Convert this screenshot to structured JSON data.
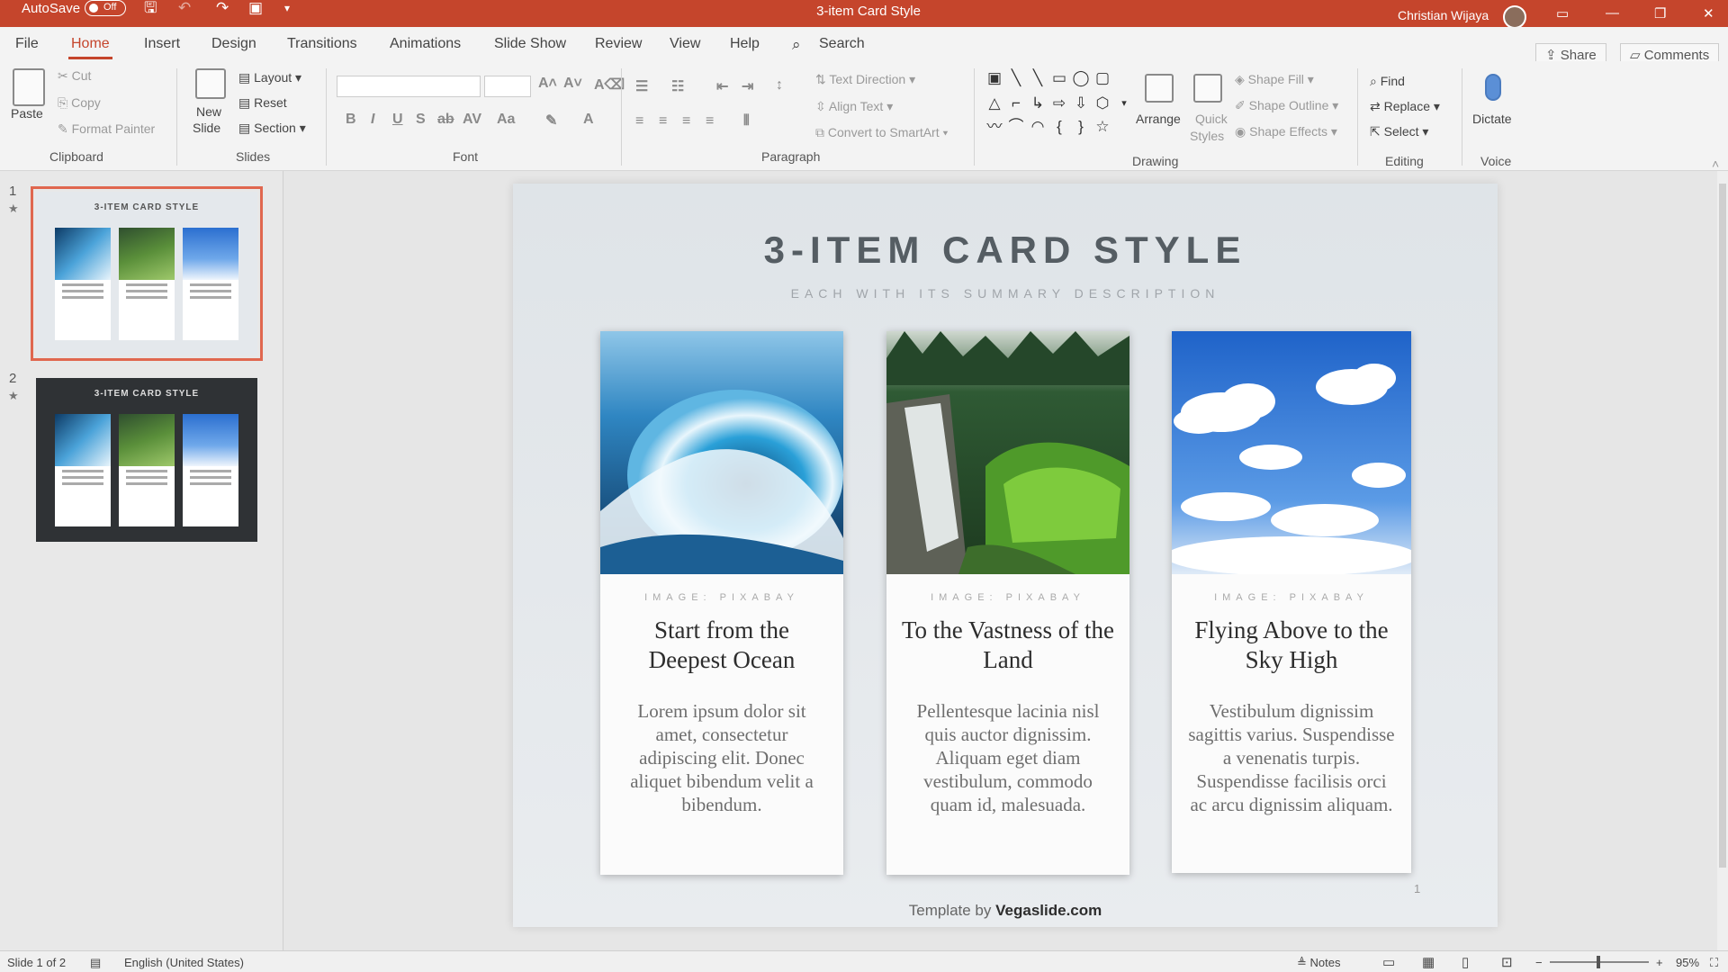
{
  "titlebar": {
    "autosave_label": "AutoSave",
    "autosave_state": "Off",
    "document_title": "3-item Card Style",
    "user_name": "Christian Wijaya"
  },
  "tabs": [
    "File",
    "Home",
    "Insert",
    "Design",
    "Transitions",
    "Animations",
    "Slide Show",
    "Review",
    "View",
    "Help"
  ],
  "active_tab": "Home",
  "search_label": "Search",
  "share_label": "Share",
  "comments_label": "Comments",
  "ribbon": {
    "clipboard": {
      "paste": "Paste",
      "cut": "Cut",
      "copy": "Copy",
      "format_painter": "Format Painter",
      "label": "Clipboard"
    },
    "slides": {
      "new_slide_line1": "New",
      "new_slide_line2": "Slide",
      "layout": "Layout",
      "reset": "Reset",
      "section": "Section",
      "label": "Slides"
    },
    "font": {
      "label": "Font"
    },
    "paragraph": {
      "text_direction": "Text Direction",
      "align_text": "Align Text",
      "convert_smartart": "Convert to SmartArt",
      "label": "Paragraph"
    },
    "drawing": {
      "arrange": "Arrange",
      "quick_line1": "Quick",
      "quick_line2": "Styles",
      "shape_fill": "Shape Fill",
      "shape_outline": "Shape Outline",
      "shape_effects": "Shape Effects",
      "label": "Drawing"
    },
    "editing": {
      "find": "Find",
      "replace": "Replace",
      "select": "Select",
      "label": "Editing"
    },
    "voice": {
      "dictate": "Dictate",
      "label": "Voice"
    }
  },
  "thumbnails": [
    {
      "number": "1",
      "title": "3-ITEM CARD STYLE",
      "theme": "light"
    },
    {
      "number": "2",
      "title": "3-ITEM CARD STYLE",
      "theme": "dark"
    }
  ],
  "slide": {
    "title": "3-ITEM CARD STYLE",
    "subtitle": "EACH WITH ITS SUMMARY DESCRIPTION",
    "cards": [
      {
        "credit": "IMAGE: PIXABAY",
        "title": "Start from the Deepest Ocean",
        "body": "Lorem ipsum dolor sit amet, consectetur adipiscing elit. Donec aliquet bibendum velit a bibendum.",
        "image": "ocean-wave"
      },
      {
        "credit": "IMAGE: PIXABAY",
        "title": "To the Vastness of the Land",
        "body": "Pellentesque lacinia nisl quis auctor dignissim. Aliquam eget diam vestibulum, commodo quam id, malesuada.",
        "image": "waterfall-forest"
      },
      {
        "credit": "IMAGE: PIXABAY",
        "title": "Flying Above to the Sky High",
        "body": "Vestibulum dignissim sagittis varius. Suspendisse a venenatis turpis. Suspendisse facilisis orci ac arcu dignissim aliquam.",
        "image": "clouds-sky"
      }
    ],
    "footer_prefix": "Template by",
    "footer_brand": "Vegaslide.com",
    "page_number": "1"
  },
  "statusbar": {
    "slide_info": "Slide 1 of 2",
    "language": "English (United States)",
    "notes_label": "Notes",
    "zoom": "95%"
  },
  "colors": {
    "accent": "#c5452c",
    "selection": "#e0674f"
  }
}
